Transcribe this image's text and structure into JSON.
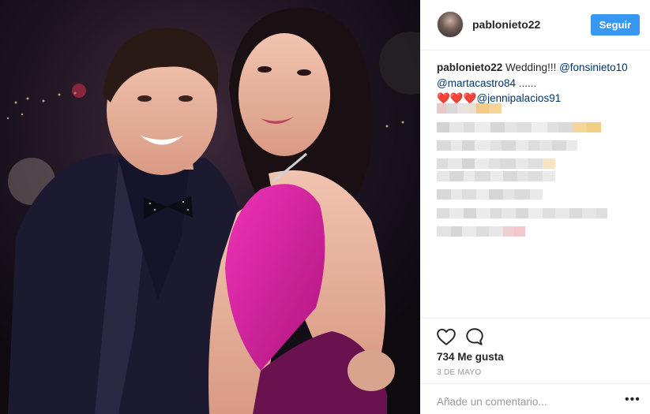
{
  "post": {
    "username": "pablonieto22",
    "follow_label": "Seguir",
    "caption": {
      "author": "pablonieto22",
      "text": "Wedding!!!",
      "mention1": "@fonsinieto10",
      "mention2": "@martacastro84",
      "ellipsis": "......",
      "hearts": "❤️❤️❤️",
      "mention3": "@jennipalacios91"
    },
    "likes": "734 Me gusta",
    "date": "3 DE MAYO",
    "comment_placeholder": "Añade un comentario...",
    "more_label": "•••"
  },
  "icons": {
    "like": "heart-outline-icon",
    "comment": "comment-bubble-icon",
    "more": "more-options-icon"
  },
  "colors": {
    "follow_button": "#3897f0",
    "mention": "#003569",
    "dress": "#d61fa3"
  }
}
